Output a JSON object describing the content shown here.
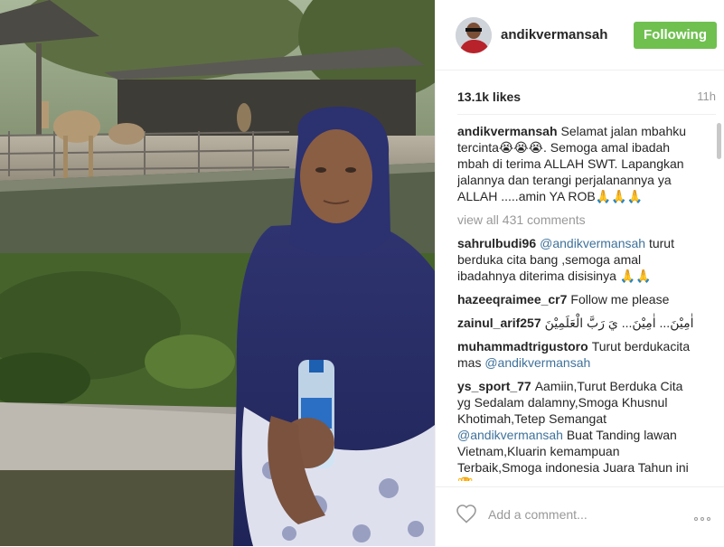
{
  "post": {
    "username": "andikvermansah",
    "follow_label": "Following",
    "likes": "13.1k likes",
    "time": "11h",
    "caption_user": "andikvermansah",
    "caption_1": "Selamat jalan mbahku tercinta",
    "caption_emoji_1": "😭😭😭",
    "caption_2": ". Semoga amal ibadah mbah di terima ALLAH SWT. Lapangkan jalannya dan terangi perjalanannya ya ALLAH .....amin YA ROB",
    "caption_emoji_2": "🙏🙏🙏"
  },
  "view_all": "view all 431 comments",
  "comments": [
    {
      "user": "sahrulbudi96",
      "mention": "@andikvermansah",
      "text": " turut berduka cita bang ,semoga amal ibadahnya diterima disisinya ",
      "emoji": "🙏🙏"
    },
    {
      "user": "hazeeqraimee_cr7",
      "text": "Follow me please"
    },
    {
      "user": "zainul_arif257",
      "text": "اٰمِيْنَ... اٰمِيْنَ... يَ رَبَّ الْعَلَمِيْنَ"
    },
    {
      "user": "muhammadtrigustoro",
      "text": "Turut berdukacita mas ",
      "mention": "@andikvermansah"
    },
    {
      "user": "ys_sport_77",
      "text": "Aamiin,Turut Berduka Cita yg Sedalam dalamny,Smoga Khusnul Khotimah,Tetep Semangat ",
      "mention": "@andikvermansah",
      "text2": " Buat Tanding lawan Vietnam,Kluarin kemampuan Terbaik,Smoga indonesia Juara Tahun ini ",
      "emoji": "🏆"
    }
  ],
  "footer": {
    "add_comment_placeholder": "Add a comment..."
  },
  "colors": {
    "follow": "#70c050",
    "mention": "#3f729b",
    "muted": "#999999"
  },
  "icons": {
    "heart": "heart-icon",
    "more": "more-options-icon"
  }
}
